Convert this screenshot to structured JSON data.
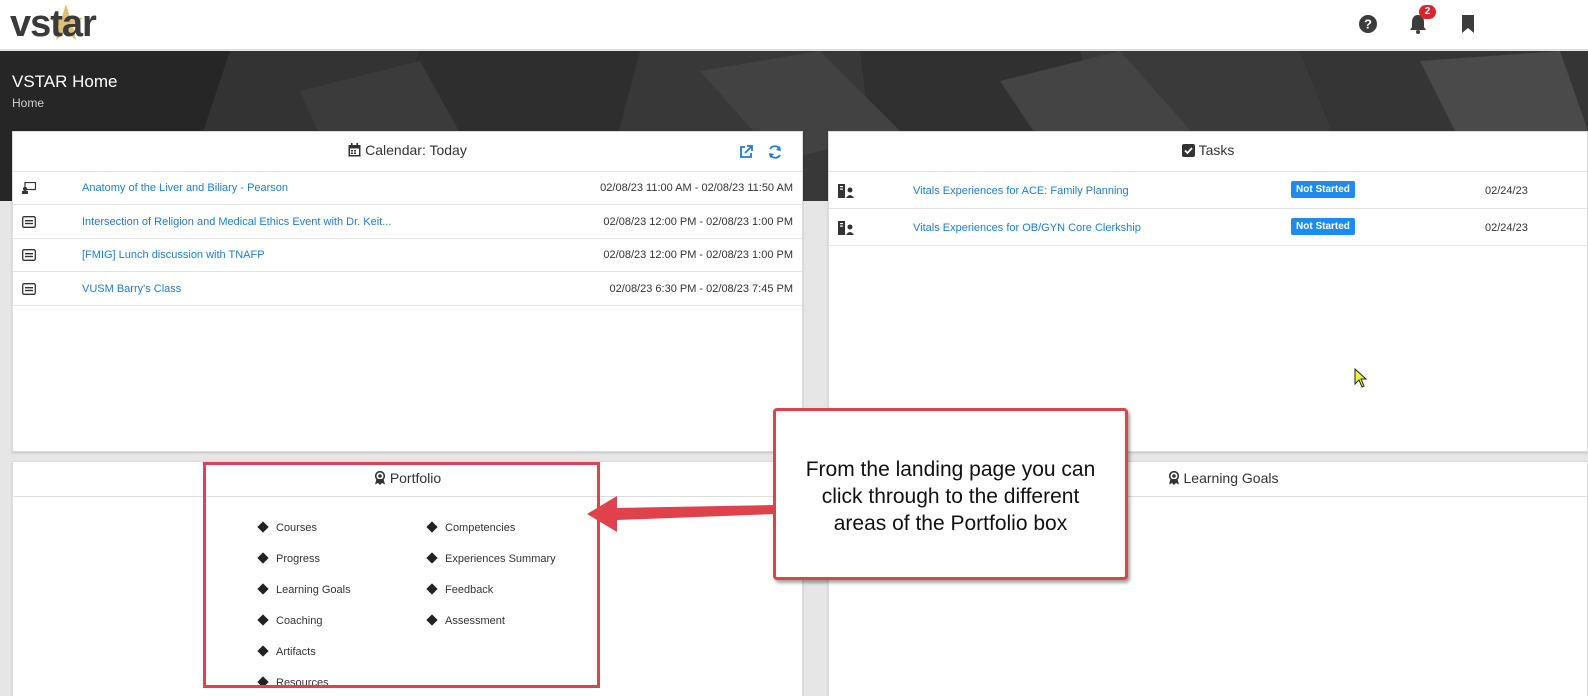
{
  "header": {
    "logo_text": "vstar",
    "notification_count": "2",
    "icons": [
      "help-icon",
      "bell-icon",
      "bookmark-icon"
    ]
  },
  "hero": {
    "title": "VSTAR Home",
    "breadcrumb": "Home"
  },
  "calendar": {
    "title": "Calendar: Today",
    "events": [
      {
        "icon": "presentation-icon",
        "title": "Anatomy of the Liver and Biliary - Pearson",
        "time": "02/08/23 11:00 AM - 02/08/23 11:50 AM"
      },
      {
        "icon": "event-icon",
        "title": "Intersection of Religion and Medical Ethics Event with Dr. Keit...",
        "time": "02/08/23 12:00 PM - 02/08/23 1:00 PM"
      },
      {
        "icon": "event-icon",
        "title": "[FMIG] Lunch discussion with TNAFP",
        "time": "02/08/23 12:00 PM - 02/08/23 1:00 PM"
      },
      {
        "icon": "event-icon",
        "title": "VUSM Barry's Class",
        "time": "02/08/23 6:30 PM - 02/08/23 7:45 PM"
      }
    ]
  },
  "tasks": {
    "title": "Tasks",
    "items": [
      {
        "title": "Vitals Experiences for ACE: Family Planning",
        "status": "Not Started",
        "date": "02/24/23"
      },
      {
        "title": "Vitals Experiences for OB/GYN Core Clerkship",
        "status": "Not Started",
        "date": "02/24/23"
      }
    ]
  },
  "portfolio": {
    "title": "Portfolio",
    "left_links": [
      "Courses",
      "Progress",
      "Learning Goals",
      "Coaching",
      "Artifacts",
      "Resources"
    ],
    "right_links": [
      "Competencies",
      "Experiences Summary",
      "Feedback",
      "Assessment"
    ]
  },
  "learning_goals": {
    "title": "Learning Goals"
  },
  "annotation": {
    "callout_line1": "From the landing page you can",
    "callout_line2": "click through to the different",
    "callout_line3": "areas of the Portfolio box"
  },
  "colors": {
    "link": "#1e7bd6",
    "badge": "#1e8bf0",
    "annotation_red": "#e0424b",
    "notification_red": "#d9262b"
  }
}
